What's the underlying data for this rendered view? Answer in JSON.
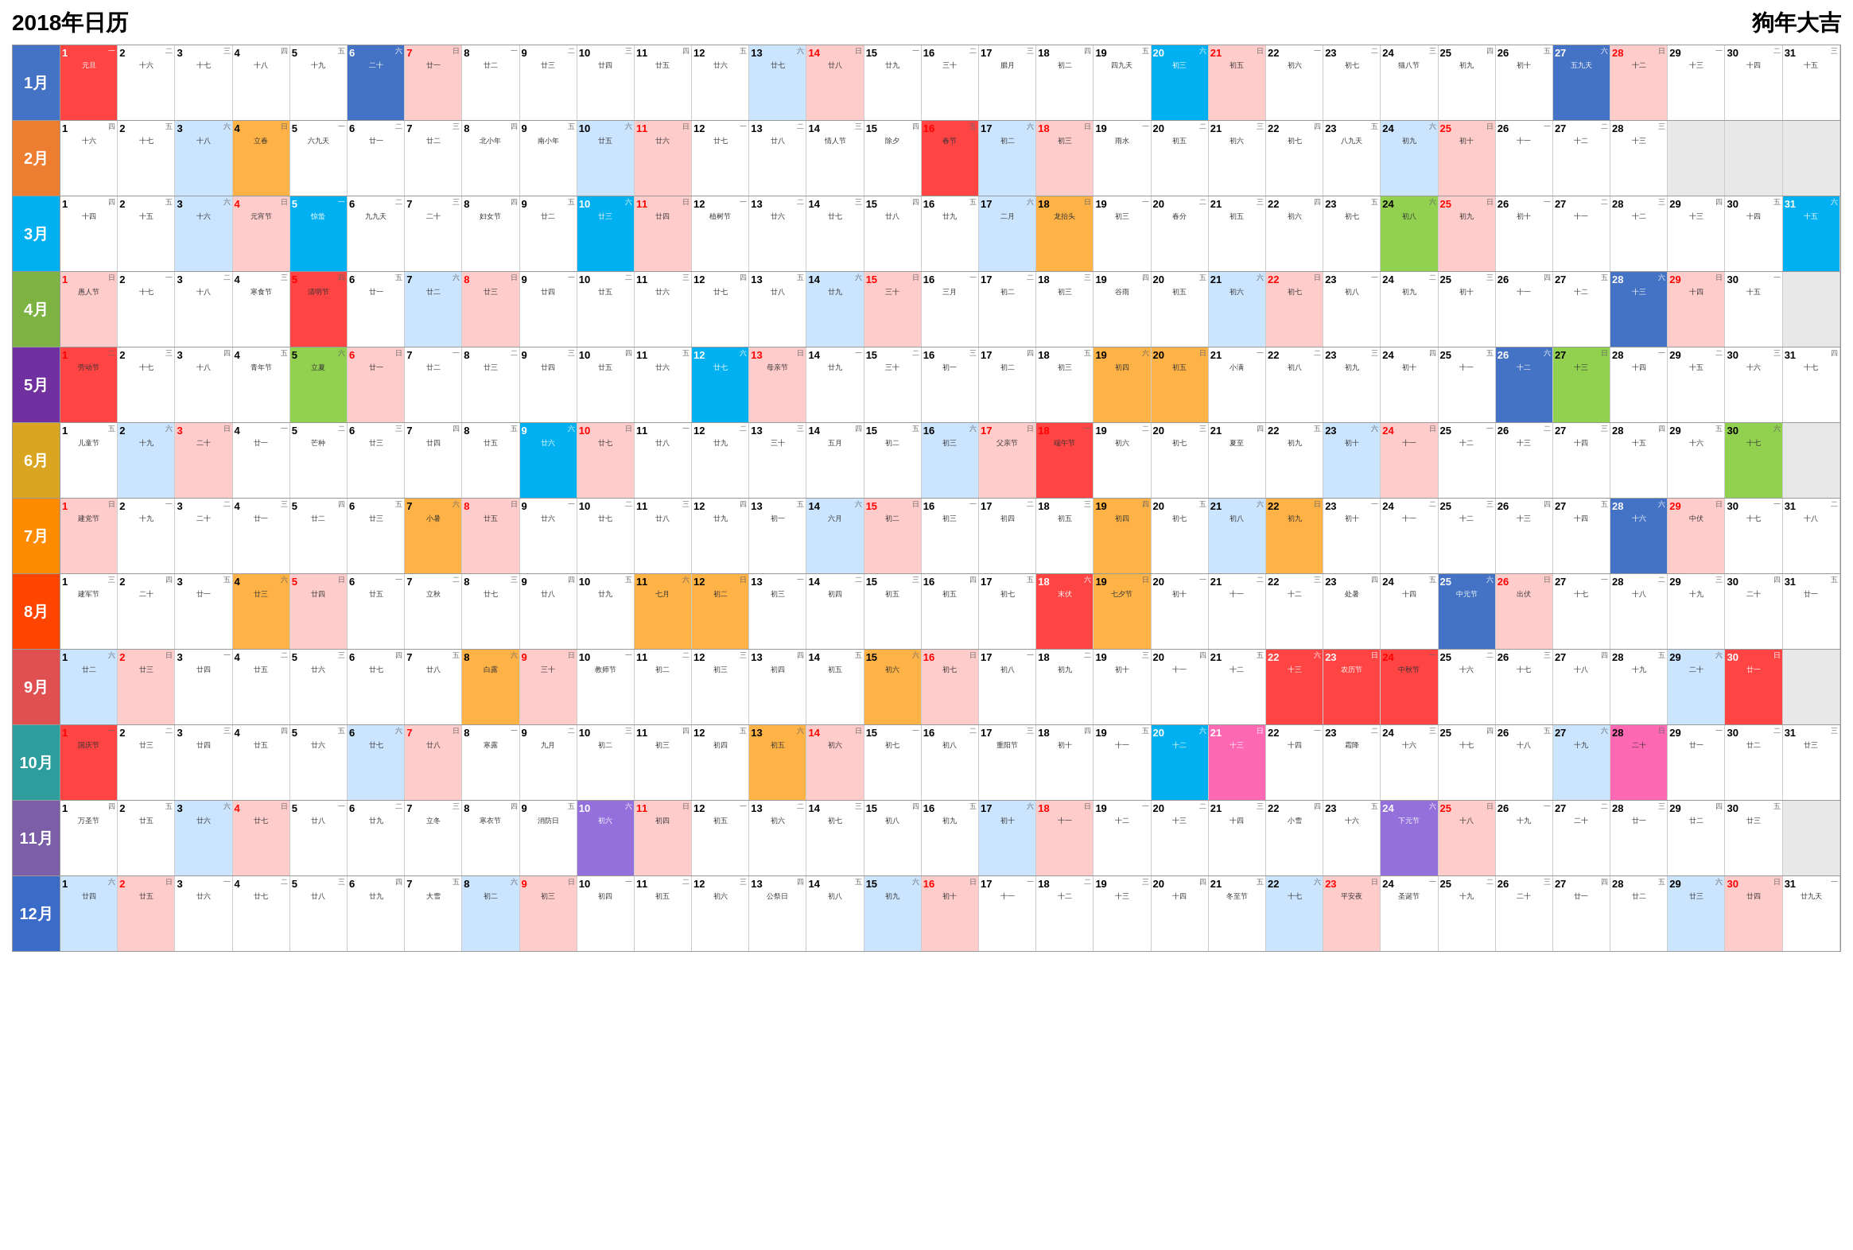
{
  "header": {
    "title": "2018年日历",
    "subtitle": "狗年大吉"
  },
  "months": [
    {
      "name": "1月",
      "colorClass": "month-jan",
      "days": 31,
      "startDow": 1
    },
    {
      "name": "2月",
      "colorClass": "month-feb",
      "days": 28,
      "startDow": 4
    },
    {
      "name": "3月",
      "colorClass": "month-mar",
      "days": 31,
      "startDow": 4
    },
    {
      "name": "4月",
      "colorClass": "month-apr",
      "days": 30,
      "startDow": 0
    },
    {
      "name": "5月",
      "colorClass": "month-may",
      "days": 31,
      "startDow": 2
    },
    {
      "name": "6月",
      "colorClass": "month-jun",
      "days": 30,
      "startDow": 5
    },
    {
      "name": "7月",
      "colorClass": "month-jul",
      "days": 31,
      "startDow": 0
    },
    {
      "name": "8月",
      "colorClass": "month-aug",
      "days": 31,
      "startDow": 3
    },
    {
      "name": "9月",
      "colorClass": "month-sep",
      "days": 30,
      "startDow": 6
    },
    {
      "name": "10月",
      "colorClass": "month-oct",
      "days": 31,
      "startDow": 1
    },
    {
      "name": "11月",
      "colorClass": "month-nov",
      "days": 30,
      "startDow": 4
    },
    {
      "name": "12月",
      "colorClass": "month-dec",
      "days": 31,
      "startDow": 6
    }
  ]
}
